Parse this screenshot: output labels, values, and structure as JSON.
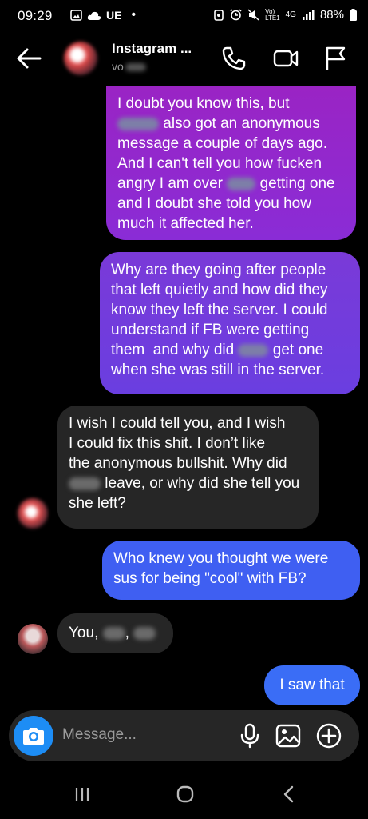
{
  "status_bar": {
    "time": "09:29",
    "left_icons": [
      "gallery-icon",
      "cloud-icon",
      "carrier-label",
      "dot-icon"
    ],
    "carrier": "UE",
    "right_icons": [
      "alarm-icon",
      "mute-icon",
      "volte-icon",
      "4g-icon",
      "signal-icon"
    ],
    "network": "4G",
    "battery": "88%"
  },
  "header": {
    "title": "Instagram ...",
    "subtitle": "vo",
    "icons": [
      "back-arrow-icon",
      "phone-icon",
      "video-icon",
      "flag-icon"
    ]
  },
  "messages": [
    {
      "sender": "me",
      "lines": [
        "I doubt you know this, but",
        "also got an anonymous",
        "message a couple of days ago.",
        "And I can't tell you how fucken",
        "angry I am over",
        "getting one",
        "and I doubt she told you how",
        "much it affected her."
      ]
    },
    {
      "sender": "me",
      "lines": [
        "Why are they going after people",
        "that left quietly and how did they",
        "know they left the server. I could",
        "understand if FB were getting",
        "them  and why did",
        "get one",
        "when she was still in the server."
      ]
    },
    {
      "sender": "them",
      "lines": [
        "I wish I could tell you, and I wish",
        "I could fix this shit. I don’t like",
        "the anonymous bullshit. Why did",
        "leave, or why did she tell you",
        "she left?"
      ]
    },
    {
      "sender": "me",
      "lines": [
        "Who knew you thought we were",
        "sus for being \"cool\" with FB?"
      ]
    },
    {
      "sender": "them",
      "lines": [
        "You,",
        ","
      ]
    },
    {
      "sender": "me",
      "lines": [
        "I saw that"
      ]
    }
  ],
  "composer": {
    "placeholder": "Message...",
    "icons": [
      "camera-icon",
      "microphone-icon",
      "image-icon",
      "plus-circle-icon"
    ]
  },
  "nav_bar": {
    "icons": [
      "recent-apps-icon",
      "home-icon",
      "back-icon"
    ]
  },
  "colors": {
    "sent_gradient_top": "#9a24c4",
    "sent_mid": "#6a3ee0",
    "sent_blue": "#3f5ff2",
    "received_bg": "#262626",
    "camera_button": "#1d8df5"
  }
}
